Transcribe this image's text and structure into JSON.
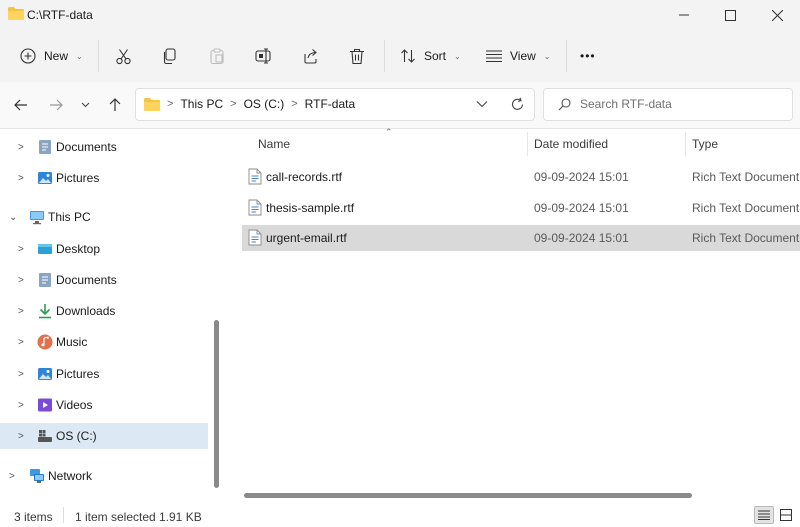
{
  "window": {
    "title": "C:\\RTF-data"
  },
  "toolbar": {
    "new_label": "New",
    "sort_label": "Sort",
    "view_label": "View",
    "more_label": "•••"
  },
  "address": {
    "crumbs": [
      "This PC",
      "OS (C:)",
      "RTF-data"
    ]
  },
  "search": {
    "placeholder": "Search RTF-data"
  },
  "sidebar": {
    "items": [
      {
        "label": "Documents",
        "icon": "documents-icon"
      },
      {
        "label": "Pictures",
        "icon": "pictures-icon"
      },
      {
        "label": "This PC",
        "icon": "this-pc-icon"
      },
      {
        "label": "Desktop",
        "icon": "desktop-icon"
      },
      {
        "label": "Documents",
        "icon": "documents-icon"
      },
      {
        "label": "Downloads",
        "icon": "downloads-icon"
      },
      {
        "label": "Music",
        "icon": "music-icon"
      },
      {
        "label": "Pictures",
        "icon": "pictures-icon"
      },
      {
        "label": "Videos",
        "icon": "videos-icon"
      },
      {
        "label": "OS (C:)",
        "icon": "drive-icon"
      },
      {
        "label": "Network",
        "icon": "network-icon"
      }
    ]
  },
  "columns": {
    "name": "Name",
    "date": "Date modified",
    "type": "Type"
  },
  "files": [
    {
      "name": "call-records.rtf",
      "date": "09-09-2024 15:01",
      "type": "Rich Text Document"
    },
    {
      "name": "thesis-sample.rtf",
      "date": "09-09-2024 15:01",
      "type": "Rich Text Document"
    },
    {
      "name": "urgent-email.rtf",
      "date": "09-09-2024 15:01",
      "type": "Rich Text Document"
    }
  ],
  "status": {
    "items": "3 items",
    "selected": "1 item selected",
    "size": "1.91 KB"
  },
  "colors": {
    "accent": "#0067c0",
    "selected_row": "#d9d9d9",
    "selected_nav": "#dde8f5",
    "folder": "#f4c542"
  }
}
